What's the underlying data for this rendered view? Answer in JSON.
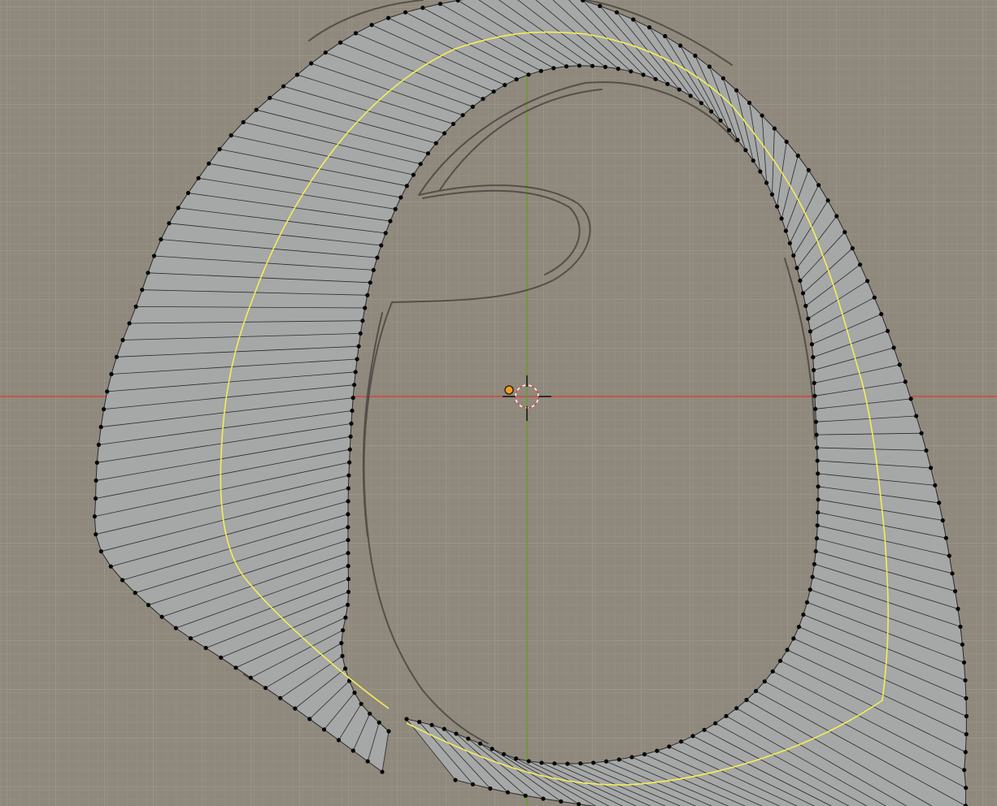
{
  "viewport": {
    "view_type": "orthographic-front",
    "background_image": "paper-sketch-letter-reference",
    "mode": "edit-mode-vertex-select"
  },
  "colors": {
    "background": "#8f887c",
    "grid_minor": "#a39d92",
    "grid_major": "#b0aa9f",
    "x_axis": "#d0463e",
    "z_axis": "#6a9a28",
    "mesh_face": "#a6a7a7",
    "mesh_edge": "#2a2a2a",
    "vertex": "#050505",
    "active_curve": "#f3ee57",
    "object_origin": "#f29d28",
    "sketch_line": "#4a4640"
  },
  "icons": {
    "cursor": "3d-cursor-icon",
    "origin": "object-origin-icon"
  }
}
